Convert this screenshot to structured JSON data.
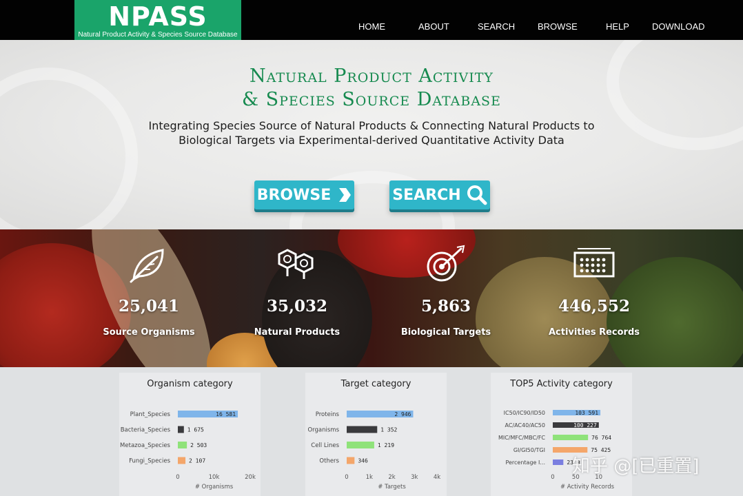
{
  "header": {
    "logo": {
      "name": "NPASS",
      "subtitle": "Natural Product Activity & Species Source Database"
    },
    "nav": [
      {
        "label": "HOME"
      },
      {
        "label": "ABOUT"
      },
      {
        "label": "SEARCH"
      },
      {
        "label": "BROWSE"
      },
      {
        "label": "HELP"
      },
      {
        "label": "DOWNLOAD"
      }
    ]
  },
  "hero": {
    "title_line1": "Natural Product Activity",
    "title_line2": "& Species Source Database",
    "desc_line1": "Integrating Species Source of Natural Products & Connecting Natural Products to",
    "desc_line2": "Biological Targets via Experimental-derived Quantitative Activity Data",
    "browse_label": "BROWSE",
    "search_label": "SEARCH",
    "accent_color": "#168a4f",
    "button_color": "#2fb6c9"
  },
  "stats": [
    {
      "value": "25,041",
      "label": "Source Organisms",
      "icon": "leaf-icon"
    },
    {
      "value": "35,032",
      "label": "Natural Products",
      "icon": "molecule-icon"
    },
    {
      "value": "5,863",
      "label": "Biological Targets",
      "icon": "target-icon"
    },
    {
      "value": "446,552",
      "label": "Activities Records",
      "icon": "chip-icon"
    }
  ],
  "chart_data": [
    {
      "type": "bar",
      "orientation": "horizontal",
      "title": "Organism category",
      "xlabel": "# Organisms",
      "categories": [
        "Plant_Species",
        "Bacteria_Species",
        "Metazoa_Species",
        "Fungi_Species"
      ],
      "values": [
        16581,
        1675,
        2503,
        2107
      ],
      "value_labels": [
        "16 581",
        "1 675",
        "2 503",
        "2 107"
      ],
      "colors": [
        "#7fb5ea",
        "#3a3a3d",
        "#8fe27a",
        "#f4a66a"
      ],
      "xlim": [
        0,
        20000
      ],
      "xticks": [
        0,
        10000,
        20000
      ],
      "xtick_labels": [
        "0",
        "10k",
        "20k"
      ]
    },
    {
      "type": "bar",
      "orientation": "horizontal",
      "title": "Target category",
      "xlabel": "# Targets",
      "categories": [
        "Proteins",
        "Organisms",
        "Cell Lines",
        "Others"
      ],
      "values": [
        2946,
        1352,
        1219,
        346
      ],
      "value_labels": [
        "2 946",
        "1 352",
        "1 219",
        "346"
      ],
      "colors": [
        "#7fb5ea",
        "#3a3a3d",
        "#8fe27a",
        "#f4a66a"
      ],
      "xlim": [
        0,
        4000
      ],
      "xticks": [
        0,
        1000,
        2000,
        3000,
        4000
      ],
      "xtick_labels": [
        "0",
        "1k",
        "2k",
        "3k",
        "4k"
      ]
    },
    {
      "type": "bar",
      "orientation": "horizontal",
      "title": "TOP5 Activity category",
      "xlabel": "# Activity Records",
      "categories": [
        "IC50/IC90/ID50",
        "AC/AC40/AC50",
        "MIC/MFC/MBC/FC",
        "GI/GI50/TGI",
        "Percentage I..."
      ],
      "values": [
        103591,
        100227,
        76764,
        75425,
        23000
      ],
      "value_labels": [
        "103 591",
        "100 227",
        "76 764",
        "75 425",
        "23 0"
      ],
      "colors": [
        "#7fb5ea",
        "#3a3a3d",
        "#8fe27a",
        "#f4a66a",
        "#7b7fe0"
      ],
      "xlim": [
        0,
        150000
      ],
      "xticks": [
        0,
        50000,
        100000
      ],
      "xtick_labels": [
        "0",
        "50",
        "10"
      ]
    }
  ],
  "watermark": "知乎 @[已重置]"
}
